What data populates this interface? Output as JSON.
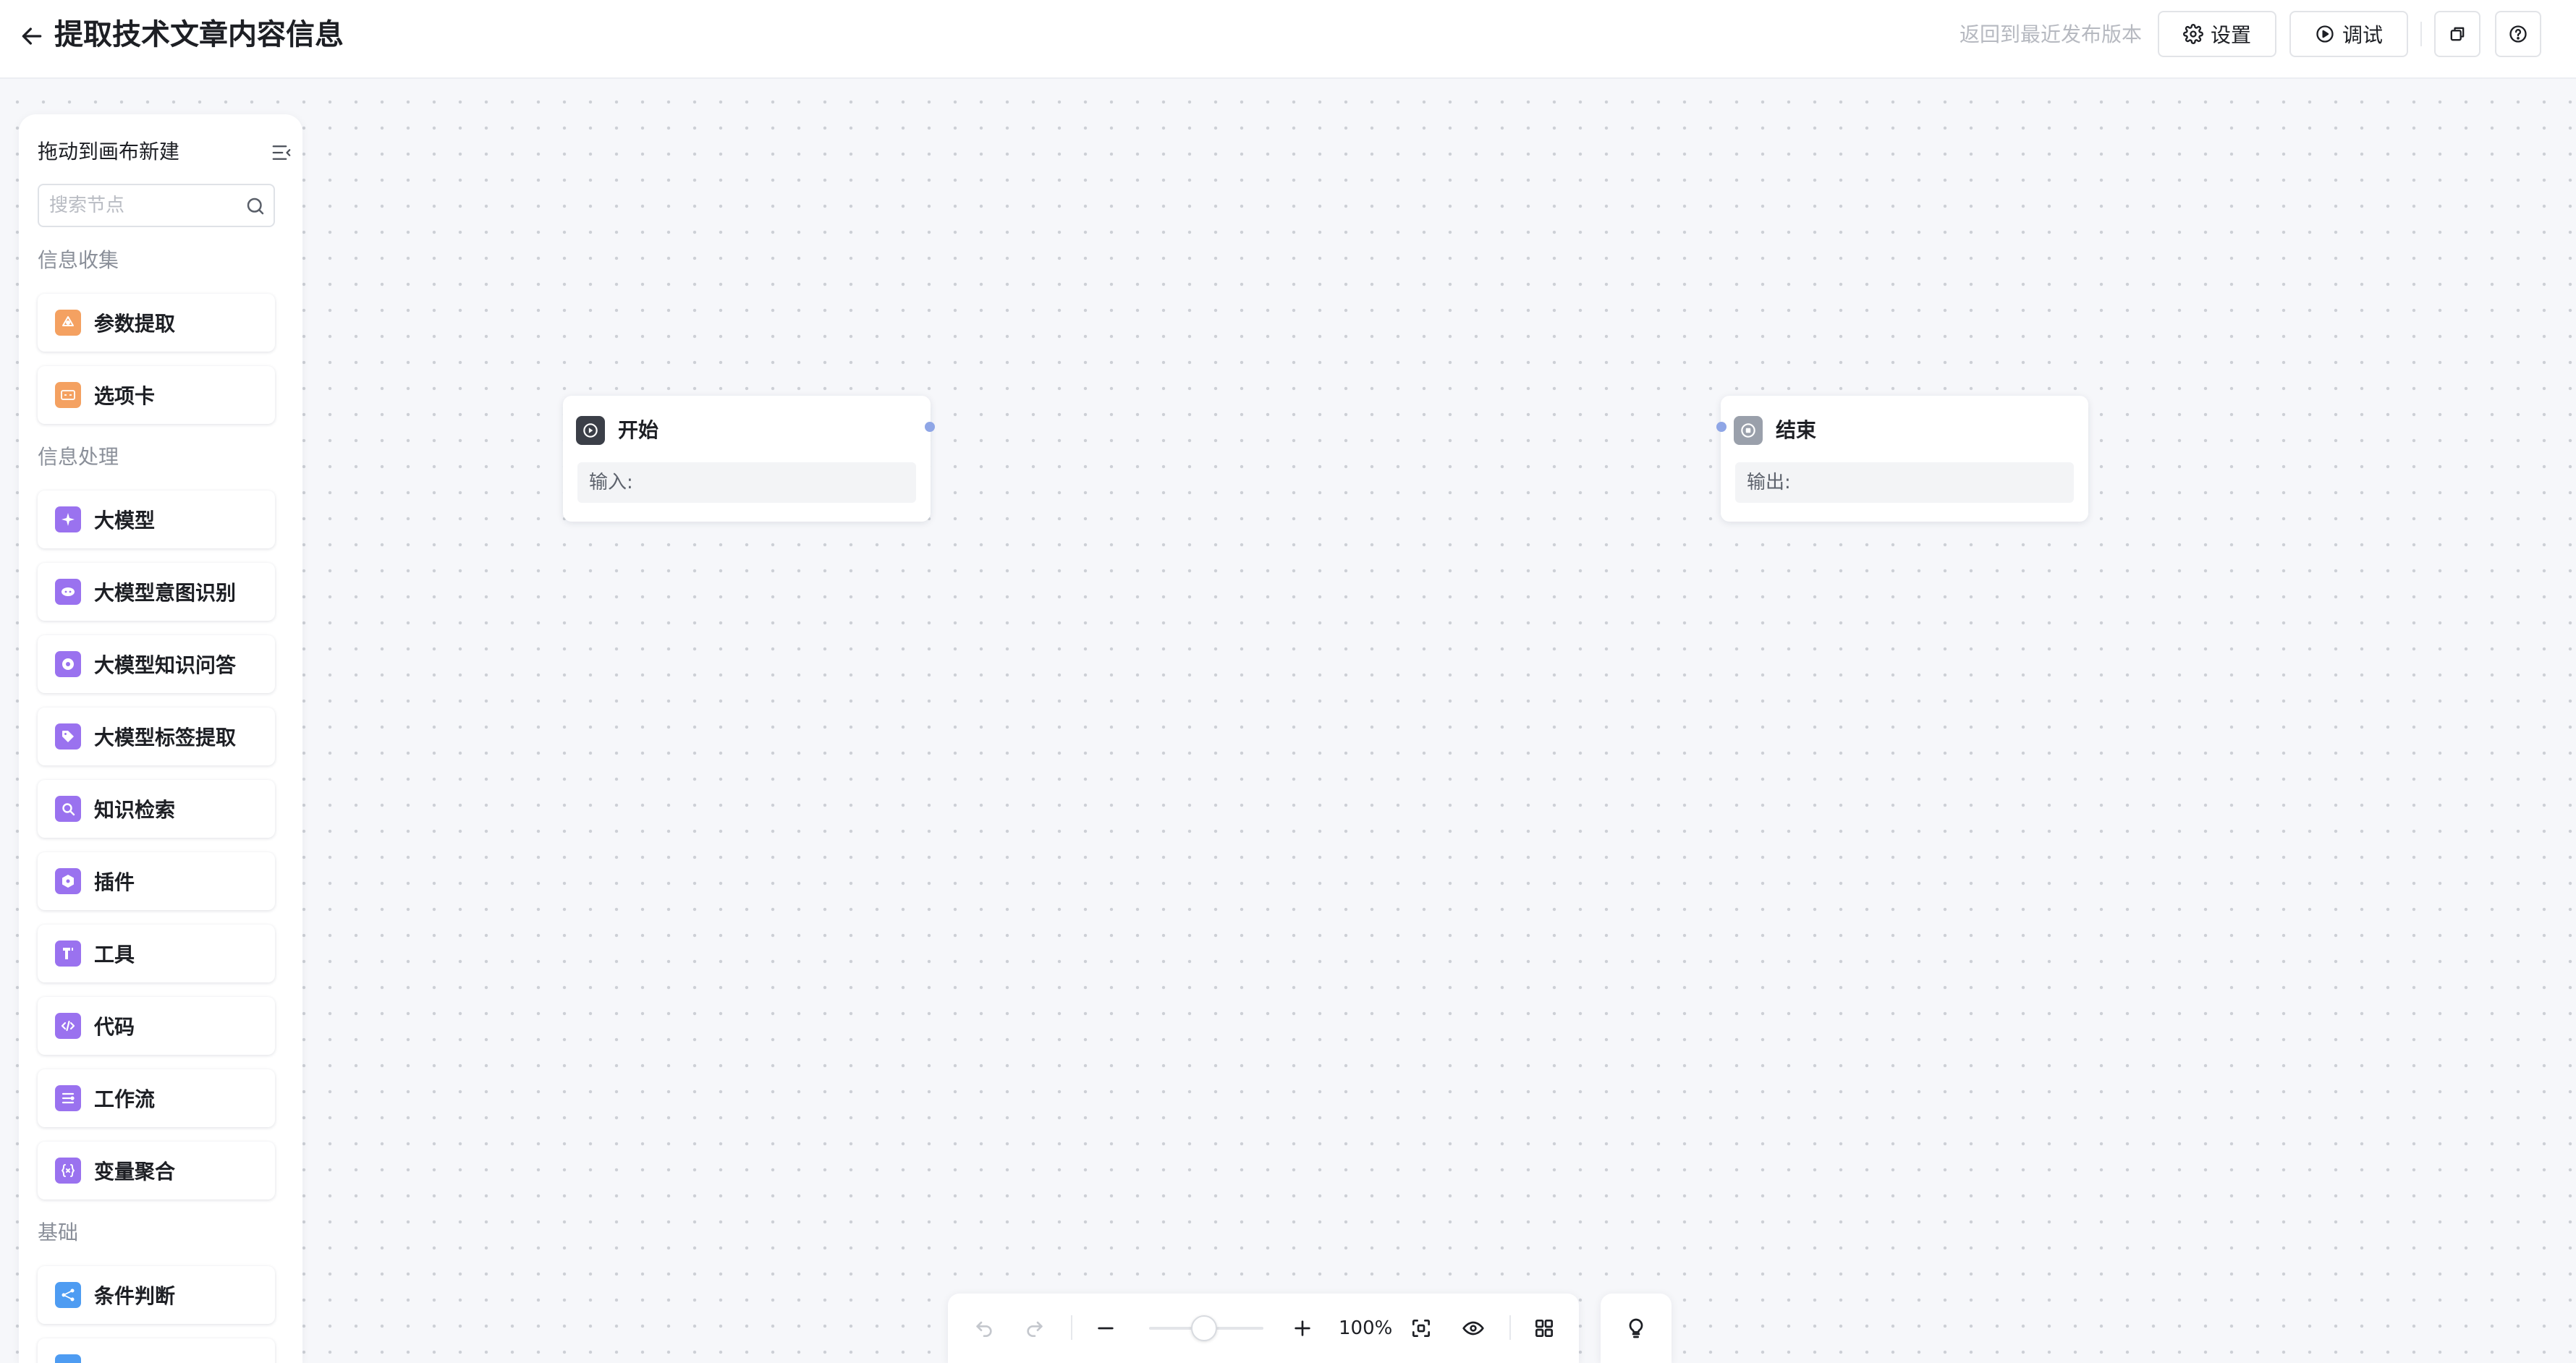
{
  "header": {
    "title": "提取技术文章内容信息",
    "revert_label": "返回到最近发布版本",
    "settings_label": "设置",
    "debug_label": "调试"
  },
  "sidebar": {
    "title": "拖动到画布新建",
    "search_placeholder": "搜索节点",
    "sections": [
      {
        "label": "信息收集",
        "items": [
          {
            "label": "参数提取",
            "icon": "parameter-extract-icon",
            "color": "#f4a161"
          },
          {
            "label": "选项卡",
            "icon": "option-card-icon",
            "color": "#f4a161"
          }
        ]
      },
      {
        "label": "信息处理",
        "items": [
          {
            "label": "大模型",
            "icon": "sparkle-icon",
            "color": "#9a72ef"
          },
          {
            "label": "大模型意图识别",
            "icon": "intent-recognition-icon",
            "color": "#9a72ef"
          },
          {
            "label": "大模型知识问答",
            "icon": "knowledge-qa-icon",
            "color": "#9a72ef"
          },
          {
            "label": "大模型标签提取",
            "icon": "tag-icon",
            "color": "#9a72ef"
          },
          {
            "label": "知识检索",
            "icon": "knowledge-search-icon",
            "color": "#9a72ef"
          },
          {
            "label": "插件",
            "icon": "plugin-icon",
            "color": "#9a72ef"
          },
          {
            "label": "工具",
            "icon": "tool-icon",
            "color": "#9a72ef"
          },
          {
            "label": "代码",
            "icon": "code-icon",
            "color": "#9a72ef"
          },
          {
            "label": "工作流",
            "icon": "workflow-icon",
            "color": "#9a72ef"
          },
          {
            "label": "变量聚合",
            "icon": "variable-aggregate-icon",
            "color": "#9a72ef"
          }
        ]
      },
      {
        "label": "基础",
        "items": [
          {
            "label": "条件判断",
            "icon": "condition-branch-icon",
            "color": "#4e9cf2"
          }
        ]
      }
    ]
  },
  "canvas": {
    "nodes": [
      {
        "title": "开始",
        "field_label": "输入:",
        "icon": "play-icon",
        "color": "#3b3f48"
      },
      {
        "title": "结束",
        "field_label": "输出:",
        "icon": "stop-icon",
        "color": "#9aa0ab"
      }
    ]
  },
  "toolbar": {
    "zoom_value": "100%",
    "zoom_level": 1.0
  },
  "colors": {
    "accent_orange": "#f4a161",
    "accent_purple": "#9a72ef",
    "accent_blue": "#4e9cf2",
    "port": "#8fa6e6"
  }
}
